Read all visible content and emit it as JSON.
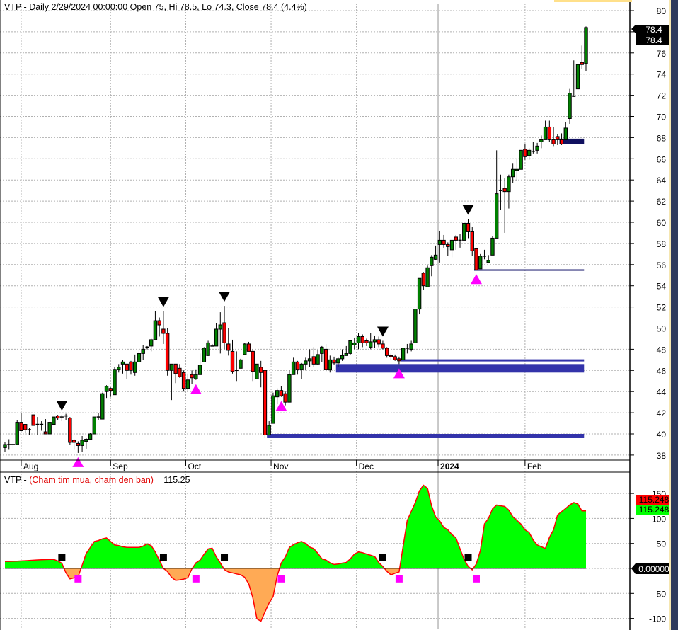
{
  "header": {
    "title": "VTP - Daily 2/29/2024 00:00:00 Open 75, Hi 78.5, Lo 74.3, Close 78.4 (4.4%)"
  },
  "indicator_header": {
    "prefix": "VTP - ",
    "name": "(Cham tim mua, cham den ban)",
    "value": " = 115.25"
  },
  "colors": {
    "up": "#008000",
    "down": "#ff0000",
    "buy_marker": "#ff00ff",
    "sell_marker": "#000000",
    "zone": "#3333aa",
    "zone_dark": "#10105f",
    "ind_pos": "#00ff00",
    "ind_neg": "#ffaa55",
    "ind_line": "#ff0000"
  },
  "price_labels": {
    "last_close_1": "78.4",
    "last_close_2": "78.4",
    "ind_red": "115.248",
    "ind_green": "115.248",
    "zero": "0.00000"
  },
  "chart_data": [
    {
      "type": "candlestick",
      "title": "VTP - Daily",
      "ylim": [
        37,
        81
      ],
      "yticks": [
        38,
        40,
        42,
        44,
        46,
        48,
        50,
        52,
        54,
        56,
        58,
        60,
        62,
        64,
        66,
        68,
        70,
        72,
        74,
        76,
        78,
        80
      ],
      "month_ticks": [
        {
          "label": "Aug",
          "bar": 4
        },
        {
          "label": "Sep",
          "bar": 26
        },
        {
          "label": "Oct",
          "bar": 44.5
        },
        {
          "label": "Nov",
          "bar": 65.5
        },
        {
          "label": "Dec",
          "bar": 86.5
        },
        {
          "label": "2024",
          "bar": 106.6,
          "bold": true
        },
        {
          "label": "Feb",
          "bar": 128
        }
      ],
      "ohlc": [
        [
          38.7,
          39.2,
          38.3,
          39.0
        ],
        [
          39.0,
          39.5,
          38.5,
          39.0
        ],
        [
          39.0,
          39.1,
          38.6,
          39.0
        ],
        [
          39.0,
          41.3,
          39.0,
          41.1
        ],
        [
          41.1,
          42.0,
          40.3,
          40.3
        ],
        [
          40.9,
          40.9,
          40.1,
          40.4
        ],
        [
          40.4,
          40.6,
          39.9,
          40.4
        ],
        [
          41.8,
          41.8,
          40.8,
          40.8
        ],
        [
          40.9,
          41.6,
          39.9,
          40.9
        ],
        [
          40.9,
          41.2,
          40.3,
          40.9
        ],
        [
          40.2,
          41.4,
          40.0,
          40.0
        ],
        [
          40.0,
          41.0,
          40.0,
          41.1
        ],
        [
          40.9,
          41.6,
          40.9,
          41.6
        ],
        [
          41.7,
          41.8,
          41.3,
          41.5
        ],
        [
          41.6,
          41.8,
          41.2,
          41.6
        ],
        [
          41.7,
          41.9,
          41.3,
          41.7
        ],
        [
          41.5,
          41.6,
          39.0,
          39.2
        ],
        [
          39.4,
          39.5,
          38.5,
          39.2
        ],
        [
          39.1,
          39.3,
          38.2,
          38.9
        ],
        [
          38.9,
          39.8,
          38.3,
          39.4
        ],
        [
          39.3,
          39.6,
          38.6,
          39.5
        ],
        [
          39.5,
          40.1,
          39.5,
          40.0
        ],
        [
          40.0,
          41.6,
          40.0,
          41.6
        ],
        [
          41.6,
          42.0,
          41.3,
          41.6
        ],
        [
          41.4,
          43.9,
          41.4,
          43.8
        ],
        [
          44.0,
          44.6,
          43.4,
          44.5
        ],
        [
          44.3,
          44.4,
          43.5,
          44.1
        ],
        [
          43.7,
          46.3,
          43.7,
          46.1
        ],
        [
          46.1,
          46.6,
          45.8,
          46.3
        ],
        [
          46.6,
          47.0,
          45.7,
          46.8
        ],
        [
          46.6,
          46.6,
          45.2,
          46.0
        ],
        [
          46.8,
          46.9,
          45.6,
          46.0
        ],
        [
          45.8,
          47.5,
          45.5,
          46.8
        ],
        [
          46.8,
          48.0,
          46.8,
          47.6
        ],
        [
          47.6,
          48.4,
          47.0,
          48.0
        ],
        [
          48.2,
          48.3,
          48.0,
          48.2
        ],
        [
          48.3,
          49.0,
          47.8,
          48.9
        ],
        [
          48.9,
          51.6,
          48.9,
          50.7
        ],
        [
          50.7,
          51.0,
          49.2,
          50.3
        ],
        [
          49.9,
          51.6,
          48.5,
          49.5
        ],
        [
          49.5,
          50.0,
          45.5,
          46.0
        ],
        [
          46.0,
          46.6,
          43.2,
          46.6
        ],
        [
          46.6,
          46.6,
          44.8,
          45.7
        ],
        [
          46.2,
          46.6,
          45.3,
          45.4
        ],
        [
          45.8,
          46.0,
          44.0,
          44.3
        ],
        [
          44.3,
          45.7,
          44.0,
          45.1
        ],
        [
          45.6,
          46.0,
          44.7,
          45.3
        ],
        [
          45.2,
          46.1,
          45.1,
          45.6
        ],
        [
          45.6,
          47.6,
          45.6,
          46.5
        ],
        [
          46.8,
          48.2,
          46.8,
          48.1
        ],
        [
          47.4,
          48.8,
          47.4,
          48.6
        ],
        [
          48.3,
          48.5,
          48.3,
          48.3
        ],
        [
          48.3,
          50.5,
          48.3,
          49.9
        ],
        [
          49.9,
          51.5,
          47.6,
          50.3
        ],
        [
          50.5,
          52.1,
          48.0,
          48.6
        ],
        [
          48.5,
          50.0,
          47.4,
          47.9
        ],
        [
          47.8,
          48.9,
          45.7,
          45.9
        ],
        [
          46.0,
          47.8,
          45.0,
          46.0
        ],
        [
          46.2,
          47.1,
          46.2,
          47.0
        ],
        [
          47.5,
          48.6,
          47.5,
          48.5
        ],
        [
          48.5,
          48.7,
          47.8,
          47.8
        ],
        [
          47.8,
          48.0,
          45.0,
          45.9
        ],
        [
          45.2,
          46.6,
          45.2,
          46.6
        ],
        [
          46.3,
          46.9,
          44.4,
          45.8
        ],
        [
          46.0,
          46.0,
          39.6,
          39.9
        ],
        [
          39.9,
          41.2,
          39.9,
          40.8
        ],
        [
          41.0,
          43.9,
          41.0,
          43.6
        ],
        [
          43.5,
          44.3,
          42.8,
          44.1
        ],
        [
          44.1,
          44.5,
          43.5,
          43.6
        ],
        [
          43.8,
          44.0,
          42.7,
          43.0
        ],
        [
          43.0,
          46.0,
          43.0,
          45.6
        ],
        [
          45.6,
          47.2,
          45.6,
          46.8
        ],
        [
          46.8,
          46.9,
          45.6,
          46.1
        ],
        [
          46.1,
          46.7,
          45.2,
          46.6
        ],
        [
          46.6,
          47.2,
          46.0,
          46.9
        ],
        [
          46.9,
          48.0,
          46.3,
          47.1
        ],
        [
          47.3,
          48.2,
          46.3,
          46.6
        ],
        [
          46.6,
          47.9,
          46.5,
          47.5
        ],
        [
          47.6,
          48.3,
          46.8,
          48.2
        ],
        [
          48.0,
          48.5,
          45.9,
          46.1
        ],
        [
          46.1,
          47.4,
          45.8,
          47.0
        ],
        [
          47.0,
          47.3,
          46.5,
          46.7
        ],
        [
          46.7,
          47.2,
          46.3,
          47.1
        ],
        [
          47.1,
          48.0,
          46.9,
          47.4
        ],
        [
          47.4,
          48.3,
          47.4,
          47.6
        ],
        [
          47.6,
          48.8,
          47.5,
          48.8
        ],
        [
          48.4,
          49.1,
          48.0,
          48.6
        ],
        [
          48.6,
          49.5,
          48.0,
          49.2
        ],
        [
          49.2,
          49.4,
          48.2,
          48.6
        ],
        [
          48.8,
          49.0,
          48.3,
          48.6
        ],
        [
          48.2,
          49.5,
          48.0,
          48.7
        ],
        [
          48.7,
          49.3,
          48.1,
          48.9
        ],
        [
          48.9,
          49.2,
          48.2,
          48.5
        ],
        [
          48.5,
          48.8,
          48.0,
          48.1
        ],
        [
          48.1,
          48.2,
          47.2,
          47.4
        ],
        [
          47.4,
          47.6,
          47.0,
          47.3
        ],
        [
          47.3,
          47.5,
          46.9,
          47.0
        ],
        [
          47.1,
          47.3,
          46.6,
          46.9
        ],
        [
          47.0,
          48.1,
          47.0,
          48.1
        ],
        [
          48.1,
          48.5,
          47.6,
          48.1
        ],
        [
          48.0,
          48.8,
          47.8,
          48.5
        ],
        [
          48.6,
          51.8,
          48.6,
          51.8
        ],
        [
          51.8,
          54.7,
          51.3,
          54.7
        ],
        [
          55.2,
          55.3,
          53.6,
          54.0
        ],
        [
          53.9,
          55.9,
          53.9,
          55.7
        ],
        [
          55.9,
          56.9,
          54.9,
          56.7
        ],
        [
          56.5,
          57.8,
          56.4,
          56.9
        ],
        [
          57.9,
          59.2,
          56.2,
          58.3
        ],
        [
          58.3,
          58.8,
          57.6,
          57.9
        ],
        [
          57.9,
          58.1,
          56.8,
          57.7
        ],
        [
          57.4,
          58.3,
          56.7,
          58.3
        ],
        [
          58.6,
          58.8,
          57.4,
          58.3
        ],
        [
          58.3,
          58.9,
          57.6,
          58.3
        ],
        [
          58.3,
          59.8,
          58.3,
          59.9
        ],
        [
          59.9,
          60.3,
          58.5,
          59.1
        ],
        [
          59.1,
          59.6,
          56.8,
          57.3
        ],
        [
          57.5,
          57.5,
          55.5,
          55.5
        ],
        [
          55.6,
          57.0,
          55.6,
          56.8
        ],
        [
          56.8,
          57.4,
          56.5,
          56.8
        ],
        [
          56.2,
          56.9,
          56.2,
          56.4
        ],
        [
          56.9,
          58.7,
          56.9,
          58.5
        ],
        [
          58.5,
          66.8,
          58.5,
          62.7
        ],
        [
          63.0,
          64.5,
          61.2,
          63.0
        ],
        [
          63.2,
          64.2,
          59.0,
          62.9
        ],
        [
          62.9,
          64.5,
          61.3,
          64.3
        ],
        [
          64.3,
          65.6,
          63.7,
          65.0
        ],
        [
          64.9,
          66.0,
          63.9,
          65.0
        ],
        [
          65.0,
          66.8,
          65.0,
          66.8
        ],
        [
          66.9,
          67.4,
          65.9,
          66.2
        ],
        [
          66.3,
          67.0,
          65.9,
          66.8
        ],
        [
          66.7,
          67.6,
          66.5,
          66.7
        ],
        [
          66.8,
          67.5,
          66.5,
          67.2
        ],
        [
          67.6,
          68.2,
          67.0,
          67.8
        ],
        [
          67.8,
          69.6,
          67.8,
          69.0
        ],
        [
          69.0,
          69.6,
          67.6,
          67.8
        ],
        [
          67.8,
          69.0,
          67.2,
          67.4
        ],
        [
          68.1,
          68.3,
          67.3,
          67.8
        ],
        [
          67.8,
          68.4,
          67.3,
          67.4
        ],
        [
          67.8,
          69.5,
          67.8,
          68.9
        ],
        [
          69.8,
          72.6,
          69.3,
          72.2
        ],
        [
          71.9,
          75.3,
          71.9,
          71.9
        ],
        [
          72.6,
          75.0,
          72.3,
          74.9
        ],
        [
          75.1,
          76.7,
          74.5,
          74.9
        ],
        [
          75.0,
          78.5,
          74.3,
          78.4
        ]
      ],
      "sell_signals": [
        14,
        39,
        54,
        93,
        114
      ],
      "buy_signals": [
        18,
        47,
        68,
        97,
        116
      ],
      "zones": [
        {
          "from_bar": 65,
          "to_bar": 142,
          "low": 39.6,
          "high": 40.0,
          "style": "band"
        },
        {
          "from_bar": 82,
          "to_bar": 142,
          "low": 45.8,
          "high": 46.6,
          "style": "band"
        },
        {
          "from_bar": 98,
          "to_bar": 142,
          "low": 46.85,
          "high": 47.05,
          "style": "band"
        },
        {
          "from_bar": 116,
          "to_bar": 142,
          "low": 55.45,
          "high": 55.55,
          "style": "line"
        },
        {
          "from_bar": 137,
          "to_bar": 142,
          "low": 67.4,
          "high": 67.9,
          "style": "dark"
        }
      ],
      "last_close": 78.4
    },
    {
      "type": "area",
      "title": "Cham tim mua, cham den ban",
      "ylim": [
        -120,
        175
      ],
      "yticks": [
        150,
        100,
        50,
        0,
        -50,
        -100
      ],
      "keypoints": [
        [
          0,
          14
        ],
        [
          12,
          18
        ],
        [
          13.5,
          14
        ],
        [
          16,
          -21
        ],
        [
          18,
          -17
        ],
        [
          20,
          30
        ],
        [
          22,
          54
        ],
        [
          25,
          61
        ],
        [
          27,
          47
        ],
        [
          30,
          42
        ],
        [
          33,
          42
        ],
        [
          35.5,
          50
        ],
        [
          37,
          33
        ],
        [
          39,
          0
        ],
        [
          42,
          -24
        ],
        [
          44.6,
          -21
        ],
        [
          47,
          11
        ],
        [
          50.7,
          42
        ],
        [
          53,
          11
        ],
        [
          54.5,
          -7
        ],
        [
          58.5,
          -13
        ],
        [
          60,
          -31
        ],
        [
          62.5,
          -109
        ],
        [
          65.4,
          -67
        ],
        [
          68,
          11
        ],
        [
          70.6,
          47
        ],
        [
          73,
          54
        ],
        [
          75.8,
          40
        ],
        [
          78.4,
          18
        ],
        [
          81,
          8
        ],
        [
          83.6,
          11
        ],
        [
          87,
          33
        ],
        [
          90.5,
          26
        ],
        [
          93,
          4
        ],
        [
          94.8,
          -13
        ],
        [
          97,
          -7
        ],
        [
          99,
          96
        ],
        [
          101,
          132
        ],
        [
          102.6,
          166
        ],
        [
          103.5,
          167
        ],
        [
          106,
          103
        ],
        [
          108.7,
          78
        ],
        [
          111,
          61
        ],
        [
          113,
          18
        ],
        [
          114.7,
          -4
        ],
        [
          116.4,
          11
        ],
        [
          118,
          89
        ],
        [
          120.8,
          127
        ],
        [
          123,
          124
        ],
        [
          126,
          96
        ],
        [
          128.5,
          75
        ],
        [
          131,
          47
        ],
        [
          133,
          40
        ],
        [
          134.6,
          72
        ],
        [
          136.3,
          110
        ],
        [
          138,
          120
        ],
        [
          139.8,
          132
        ],
        [
          141,
          129
        ],
        [
          142,
          115
        ]
      ],
      "sell_squares": [
        14,
        39,
        54,
        93,
        114
      ],
      "buy_squares": [
        18,
        47,
        68,
        97,
        116
      ],
      "last_value": 115.248
    }
  ]
}
